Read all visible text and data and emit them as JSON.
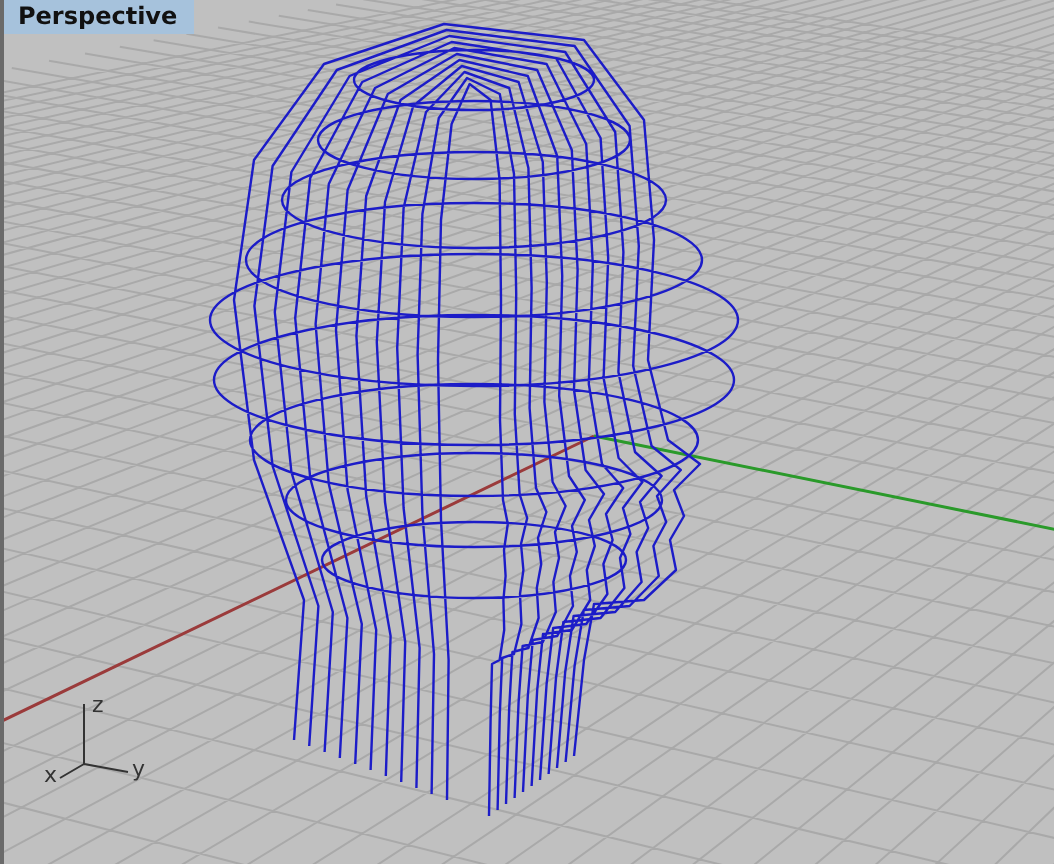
{
  "viewport": {
    "title": "Perspective",
    "axis_labels": [
      "z",
      "x",
      "y"
    ]
  }
}
